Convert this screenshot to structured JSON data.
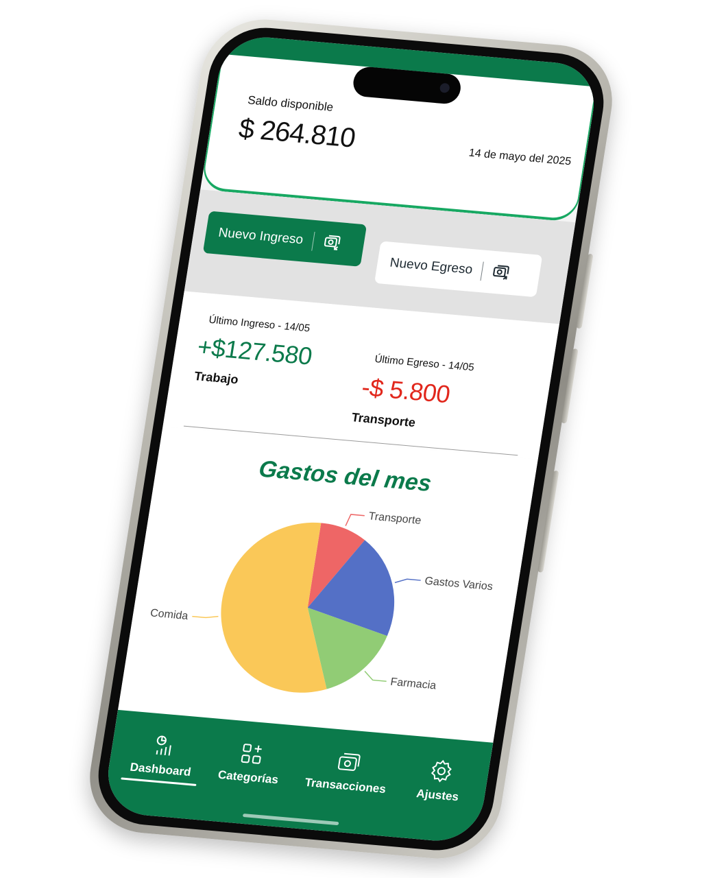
{
  "balance": {
    "label": "Saldo disponible",
    "amount": "$ 264.810",
    "date": "14 de mayo del 2025"
  },
  "actions": {
    "income_label": "Nuevo Ingreso",
    "expense_label": "Nuevo Egreso"
  },
  "last_income": {
    "label": "Último Ingreso - 14/05",
    "amount": "+$127.580",
    "category": "Trabajo"
  },
  "last_expense": {
    "label": "Último Egreso - 14/05",
    "amount": "-$ 5.800",
    "category": "Transporte"
  },
  "chart": {
    "title": "Gastos del mes"
  },
  "chart_data": {
    "type": "pie",
    "title": "Gastos del mes",
    "slices": [
      {
        "label": "Transporte",
        "value": 9,
        "color": "#ee6666"
      },
      {
        "label": "Gastos Varios",
        "value": 20,
        "color": "#5470c6"
      },
      {
        "label": "Farmacia",
        "value": 15,
        "color": "#91cc75"
      },
      {
        "label": "Comida",
        "value": 56,
        "color": "#fac858"
      }
    ]
  },
  "nav": {
    "dashboard": "Dashboard",
    "categorias": "Categorías",
    "transacciones": "Transacciones",
    "ajustes": "Ajustes"
  },
  "colors": {
    "brand_green": "#0b7a4b",
    "income_green": "#0b7a4b",
    "expense_red": "#e1271c"
  }
}
